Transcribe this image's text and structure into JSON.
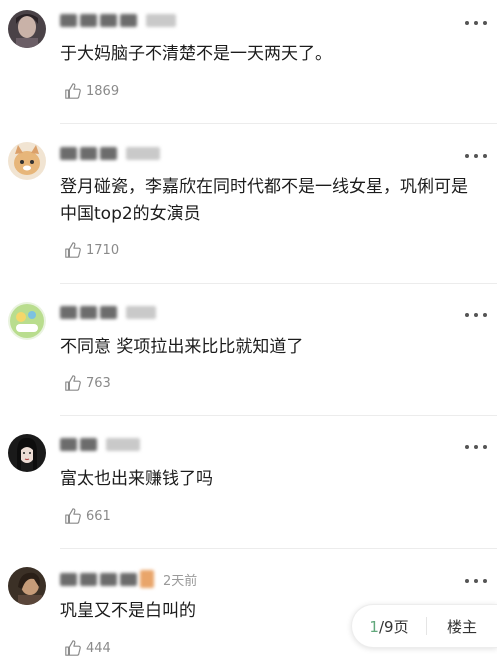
{
  "comments": [
    {
      "time": "",
      "text": "于大妈脑子不清楚不是一天两天了。",
      "likes": "1869"
    },
    {
      "time": "",
      "text": "登月碰瓷，李嘉欣在同时代都不是一线女星，巩俐可是中国top2的女演员",
      "likes": "1710"
    },
    {
      "time": "",
      "text": "不同意  奖项拉出来比比就知道了",
      "likes": "763"
    },
    {
      "time": "",
      "text": "富太也出来赚钱了吗",
      "likes": "661"
    },
    {
      "time": "2天前",
      "text": "巩皇又不是白叫的",
      "likes": "444"
    }
  ],
  "pager": {
    "current": "1",
    "total_text": "/9页",
    "floor_label": "楼主"
  },
  "colors": {
    "accent": "#62a87c",
    "text": "#1c1c1c",
    "meta": "#8a8a8a"
  }
}
